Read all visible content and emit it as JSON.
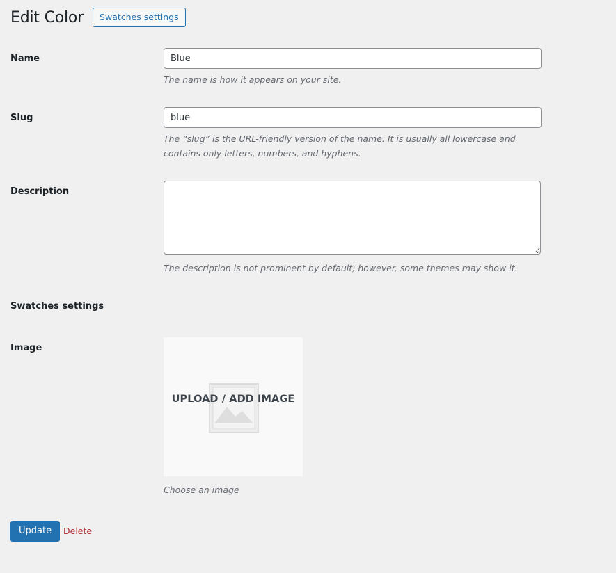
{
  "header": {
    "title": "Edit Color",
    "swatches_button": "Swatches settings"
  },
  "form": {
    "name": {
      "label": "Name",
      "value": "Blue",
      "help": "The name is how it appears on your site."
    },
    "slug": {
      "label": "Slug",
      "value": "blue",
      "help": "The “slug” is the URL-friendly version of the name. It is usually all lowercase and contains only letters, numbers, and hyphens."
    },
    "description": {
      "label": "Description",
      "value": "",
      "help": "The description is not prominent by default; however, some themes may show it."
    },
    "swatches_section": {
      "label": "Swatches settings"
    },
    "image": {
      "label": "Image",
      "upload_text": "UPLOAD / ADD IMAGE",
      "help": "Choose an image",
      "icon": "image-placeholder-icon"
    }
  },
  "actions": {
    "update": "Update",
    "delete": "Delete"
  },
  "colors": {
    "accent": "#2271b1",
    "danger": "#b32d2e",
    "background": "#f0f0f1"
  }
}
